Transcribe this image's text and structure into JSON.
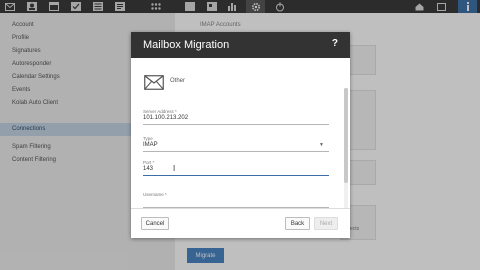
{
  "sidebar": {
    "items": [
      {
        "label": "Account"
      },
      {
        "label": "Profile"
      },
      {
        "label": "Signatures"
      },
      {
        "label": "Autoresponder"
      },
      {
        "label": "Calendar Settings"
      },
      {
        "label": "Events"
      },
      {
        "label": "Kolab Auto Client"
      },
      {
        "label": "Connections"
      },
      {
        "label": "Spam Filtering"
      },
      {
        "label": "Content Filtering"
      }
    ],
    "active_index": 7
  },
  "main": {
    "header": "IMAP Accounts",
    "cut_text": "ects",
    "migrate_label": "Migrate"
  },
  "modal": {
    "title": "Mailbox Migration",
    "help": "?",
    "provider": "Other",
    "fields": {
      "server_address": {
        "label": "Server Address *",
        "value": "101.100.213.202"
      },
      "type": {
        "label": "Type",
        "value": "IMAP"
      },
      "port": {
        "label": "Port *",
        "value": "143"
      },
      "username": {
        "label": "Username *",
        "value": ""
      }
    },
    "buttons": {
      "cancel": "Cancel",
      "back": "Back",
      "next": "Next"
    }
  },
  "colors": {
    "accent": "#3a6ea5",
    "modal_header": "#333333",
    "active_sidebar": "#c5d6e6",
    "migrate_button": "#4a86c5"
  }
}
